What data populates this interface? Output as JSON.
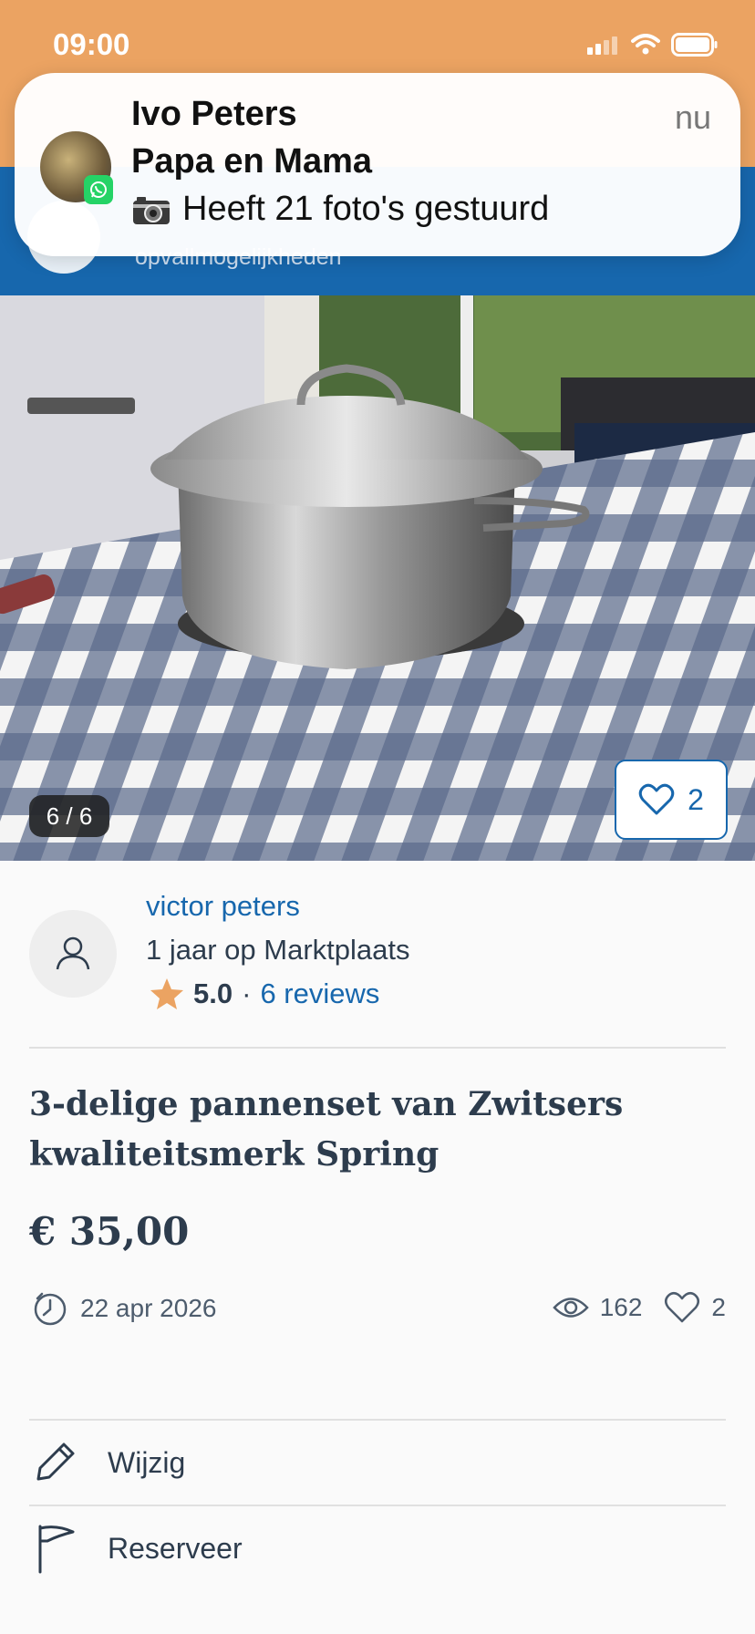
{
  "status_bar": {
    "time": "09:00"
  },
  "banner": {
    "text": "opvallmogelijkheden"
  },
  "notification": {
    "sender": "Ivo Peters",
    "group": "Papa en Mama",
    "message": "Heeft 21 foto's gestuurd",
    "time": "nu"
  },
  "gallery": {
    "counter": "6 / 6",
    "favorite_count": "2"
  },
  "seller": {
    "name": "victor peters",
    "since": "1 jaar op Marktplaats",
    "rating": "5.0",
    "separator": "·",
    "reviews": "6 reviews"
  },
  "listing": {
    "title": "3-delige pannenset van Zwitsers kwaliteitsmerk Spring",
    "price": "€ 35,00",
    "date": "22 apr 2026",
    "views": "162",
    "favorites": "2"
  },
  "actions": {
    "edit": "Wijzig",
    "reserve": "Reserveer"
  },
  "colors": {
    "header_orange": "#eba362",
    "brand_blue": "#1767ad",
    "star": "#eba362"
  }
}
